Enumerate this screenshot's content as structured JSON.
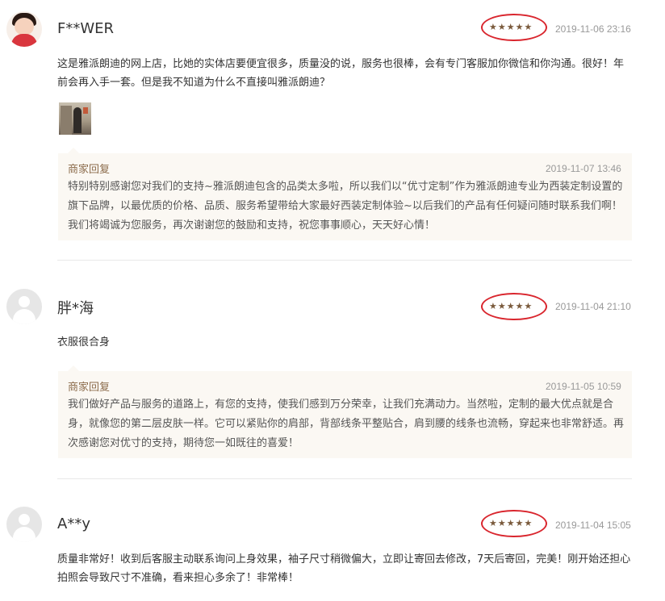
{
  "reviews": [
    {
      "username": "F**WER",
      "rating_text": "★★★★★",
      "rating": 5,
      "date": "2019-11-06 23:16",
      "text": "这是雅派朗迪的网上店，比她的实体店要便宜很多，质量没的说，服务也很棒，会有专门客服加你微信和你沟通。很好！年前会再入手一套。但是我不知道为什么不直接叫雅派朗迪？",
      "reply": {
        "label": "商家回复",
        "date": "2019-11-07 13:46",
        "text": "特别特别感谢您对我们的支持~雅派朗迪包含的品类太多啦，所以我们以“优寸定制”作为雅派朗迪专业为西装定制设置的旗下品牌，以最优质的价格、品质、服务希望带给大家最好西装定制体验~以后我们的产品有任何疑问随时联系我们啊！我们将竭诚为您服务，再次谢谢您的鼓励和支持，祝您事事顺心，天天好心情！"
      }
    },
    {
      "username": "胖*海",
      "rating_text": "★★★★★",
      "rating": 5,
      "date": "2019-11-04 21:10",
      "text": "衣服很合身",
      "reply": {
        "label": "商家回复",
        "date": "2019-11-05 10:59",
        "text": "我们做好产品与服务的道路上，有您的支持，使我们感到万分荣幸，让我们充满动力。当然啦，定制的最大优点就是合身，就像您的第二层皮肤一样。它可以紧贴你的肩部，背部线条平整贴合，肩到腰的线条也流畅，穿起来也非常舒适。再次感谢您对优寸的支持，期待您一如既往的喜爱！"
      }
    },
    {
      "username": "A**y",
      "rating_text": "★★★★★",
      "rating": 5,
      "date": "2019-11-04 15:05",
      "text": "质量非常好！收到后客服主动联系询问上身效果，袖子尺寸稍微偏大，立即让寄回去修改，7天后寄回，完美！刚开始还担心拍照会导致尺寸不准确，看来担心多余了！非常棒！"
    }
  ],
  "colors": {
    "highlight_ring": "#d9262e",
    "star": "#7a5a3c",
    "reply_label": "#8c6c4c",
    "reply_bg": "#fbf8f3"
  }
}
